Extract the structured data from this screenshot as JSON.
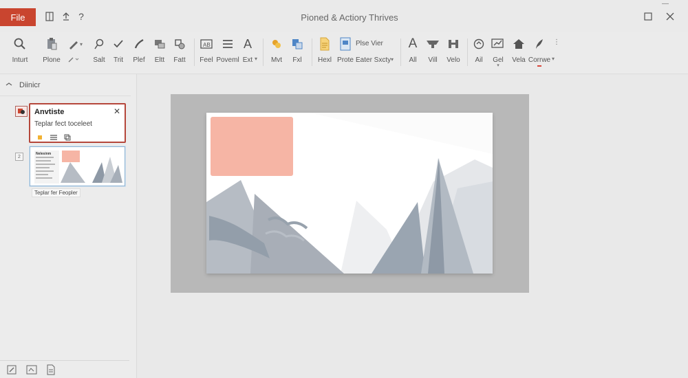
{
  "titlebar": {
    "file_label": "File",
    "doc_title": "Pioned & Actiory Thrives",
    "qa_icons": [
      "grid-icon",
      "share-icon",
      "help-icon"
    ]
  },
  "ribbon": {
    "buttons": [
      {
        "label": "Inturt",
        "icon": "search-icon"
      },
      {
        "label": "Plone",
        "icon": "clipboard-icon"
      },
      {
        "label": "",
        "icon": "pen-icon"
      },
      {
        "label": "Salt",
        "icon": "lasso-icon"
      },
      {
        "label": "Trit",
        "icon": "check-icon"
      },
      {
        "label": "Plef",
        "icon": "brush-icon"
      },
      {
        "label": "Eltt",
        "icon": "layers-icon"
      },
      {
        "label": "Fatt",
        "icon": "shapes-icon"
      },
      {
        "label": "Feel",
        "icon": "textbox-icon"
      },
      {
        "label": "Poveml",
        "icon": "list-icon"
      },
      {
        "label": "Ext",
        "icon": "font-icon"
      },
      {
        "label": "Mvt",
        "icon": "palette-icon"
      },
      {
        "label": "Fxl",
        "icon": "copy-icon"
      },
      {
        "label": "Hexl",
        "icon": "document-icon"
      },
      {
        "label": "Prote",
        "icon": "image-icon"
      },
      {
        "label": "Plse Vier",
        "icon": ""
      },
      {
        "label": "Eater Sxcty",
        "icon": ""
      },
      {
        "label": "All",
        "icon": "text-a-icon"
      },
      {
        "label": "Vill",
        "icon": "shelf-icon"
      },
      {
        "label": "Velo",
        "icon": "columns-icon"
      },
      {
        "label": "Ail",
        "icon": "target-icon"
      },
      {
        "label": "Gel",
        "icon": "chart-icon"
      },
      {
        "label": "Vela",
        "icon": "home-icon"
      },
      {
        "label": "Corrwe",
        "icon": "feather-icon"
      }
    ]
  },
  "panel": {
    "header": "Diinicr",
    "popup": {
      "title": "Anvtiste",
      "subtitle": "Teplar fect toceleet"
    },
    "slide_numbers": [
      "",
      "2"
    ],
    "thumb_caption": "Teplar fer Feopler",
    "thumb_title": "Nelesinm"
  },
  "colors": {
    "file": "#c9452f",
    "accent_salmon": "#f6b5a5",
    "mountain": "#b6bcc4",
    "dark_mountain": "#8e99a6"
  }
}
